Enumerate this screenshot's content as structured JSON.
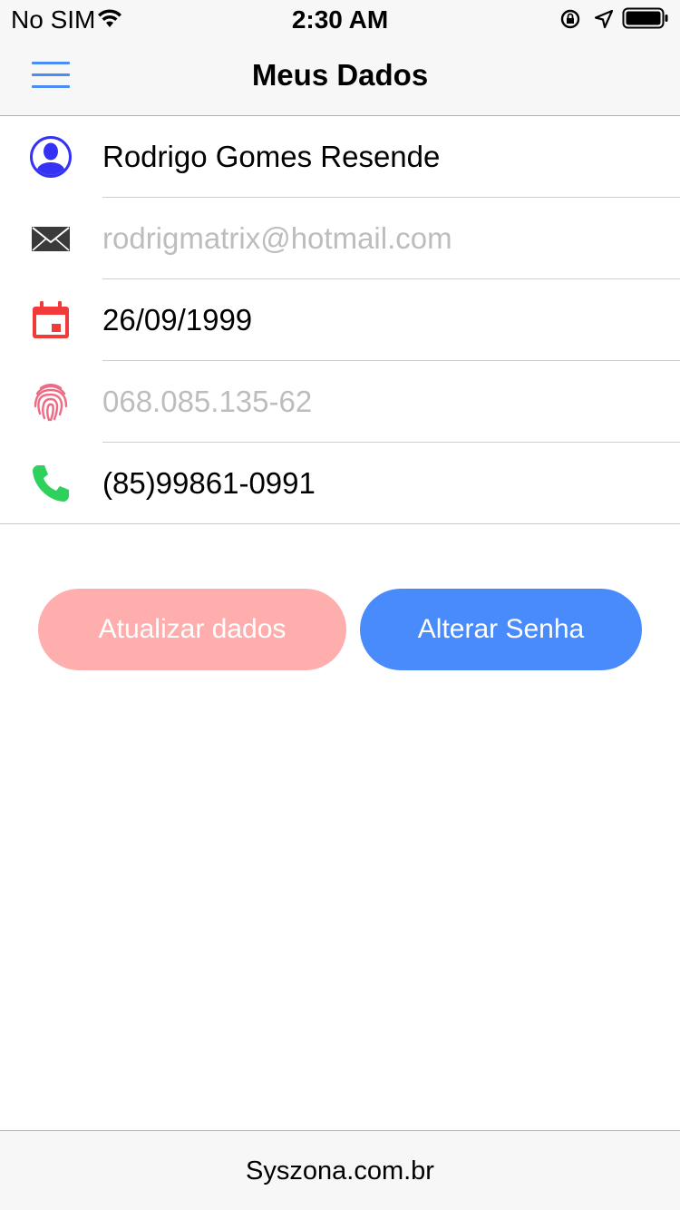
{
  "status_bar": {
    "carrier": "No SIM",
    "time": "2:30 AM"
  },
  "nav": {
    "title": "Meus Dados",
    "menu_icon": "hamburger-menu-icon"
  },
  "profile": {
    "name": {
      "value": "Rodrigo Gomes Resende",
      "icon": "user-avatar-icon",
      "icon_color": "#3532f5"
    },
    "email": {
      "value": "rodrigmatrix@hotmail.com",
      "icon": "envelope-icon",
      "icon_color": "#3a3a3a"
    },
    "birthdate": {
      "value": "26/09/1999",
      "icon": "calendar-icon",
      "icon_color": "#f23a3a"
    },
    "cpf": {
      "value": "068.085.135-62",
      "icon": "fingerprint-icon",
      "icon_color": "#ee6b86"
    },
    "phone": {
      "value": "(85)99861-0991",
      "icon": "phone-icon",
      "icon_color": "#2ed15c"
    }
  },
  "actions": {
    "update_label": "Atualizar dados",
    "change_password_label": "Alterar Senha"
  },
  "footer": {
    "text": "Syszona.com.br"
  },
  "colors": {
    "accent": "#4a8bfb",
    "update_button": "#ffaeae"
  }
}
